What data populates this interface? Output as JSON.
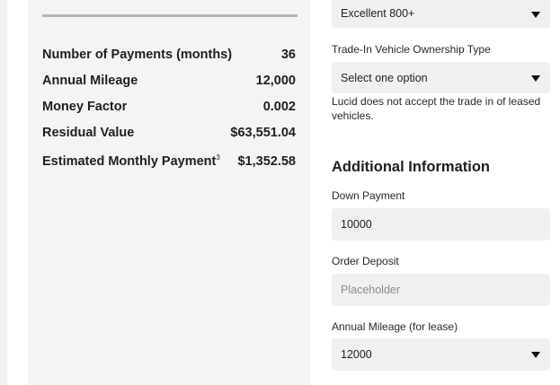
{
  "summary": {
    "rows": [
      {
        "label": "Number of Payments (months)",
        "value": "36"
      },
      {
        "label": "Annual Mileage",
        "value": "12,000"
      },
      {
        "label": "Money Factor",
        "value": "0.002"
      },
      {
        "label": "Residual Value",
        "value": "$63,551.04"
      },
      {
        "label": "Estimated Monthly Payment",
        "sup": "3",
        "value": "$1,352.58"
      }
    ]
  },
  "form": {
    "credit_score": {
      "selected": "Excellent 800+"
    },
    "trade_in": {
      "label": "Trade-In Vehicle Ownership Type",
      "selected": "Select one option",
      "note": "Lucid does not accept the trade in of leased vehicles."
    },
    "additional_info": {
      "title": "Additional Information",
      "down_payment": {
        "label": "Down Payment",
        "value": "10000"
      },
      "order_deposit": {
        "label": "Order Deposit",
        "placeholder": "Placeholder"
      },
      "annual_mileage": {
        "label": "Annual Mileage (for lease)",
        "selected": "12000"
      }
    }
  },
  "icons": {
    "dropdown": "chevron-down-icon"
  }
}
